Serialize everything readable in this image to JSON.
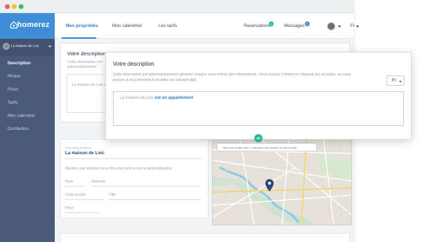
{
  "browser": {
    "controls": [
      "close",
      "minimize",
      "maximize"
    ]
  },
  "brand": {
    "name": "homerez",
    "icon": "house-icon",
    "color": "#3f8fd8"
  },
  "sidebar": {
    "property": {
      "name": "La maison de Loic"
    },
    "items": [
      {
        "label": "Description",
        "active": true
      },
      {
        "label": "Photos",
        "active": false
      },
      {
        "label": "Pricer",
        "active": false
      },
      {
        "label": "Tarifs",
        "active": false
      },
      {
        "label": "Mon calendrier",
        "active": false
      },
      {
        "label": "Distribution",
        "active": false
      }
    ]
  },
  "topnav": {
    "tabs": [
      {
        "label": "Mes propriétés",
        "active": true
      },
      {
        "label": "Mon calendrier",
        "active": false
      },
      {
        "label": "Les tarifs",
        "active": false
      }
    ],
    "reservations": {
      "label": "Reservations",
      "count": "0"
    },
    "messages": {
      "label": "Messages",
      "count": "0"
    },
    "lang": "Fr"
  },
  "background": {
    "title": "Votre description",
    "text": "Cette description est automatiquement générée lorsque vous entrez des informations. Vous pouvez l'utiliser en cliquant accepter, ou vous pouvez",
    "textarea": "La maison de Loic est un appartement"
  },
  "address": {
    "field_label": "Nom de la résidence",
    "name": "La maison de Loic",
    "hint": "Ajoutez une adresse pour être plus précis sur la géolocalisation",
    "placeholders": {
      "num": "Num",
      "street": "Adresse",
      "postal": "Code postal",
      "city": "Ville",
      "country": "Pays"
    }
  },
  "map": {
    "note": "Merci de vérifier que le marqueur est localisé au bon endroit",
    "pin_color": "#2a4a7a",
    "button_icon": "chevron-up-icon"
  },
  "modal": {
    "title": "Votre description",
    "desc_pre": "Cette description est automatiquement générée lorsque vous entrez des informations. Vous pouvez l'utiliser en cliquant sur accepter, ou vous pouvez à tout moment la modifier en cliquant",
    "desc_link": "ici",
    "lang": "Fr",
    "text_plain": "La maison de Loic",
    "text_highlight": "est un appartement"
  },
  "colors": {
    "sidebar": "#4a5a7a",
    "accent": "#2f7fd0",
    "teal": "#2cb79a",
    "badge": "#2cb79a"
  }
}
